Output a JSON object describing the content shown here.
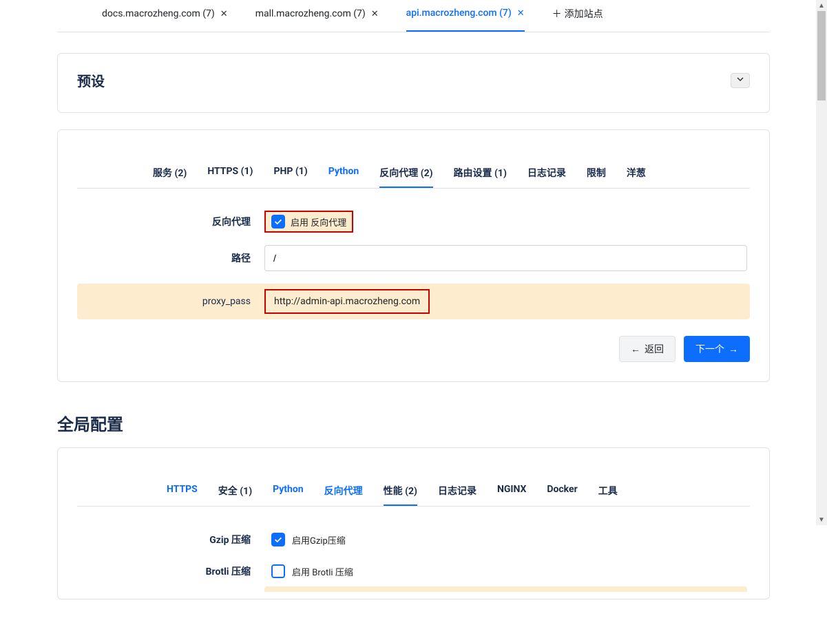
{
  "siteTabs": {
    "tab1": "docs.macrozheng.com (7)",
    "tab2": "mall.macrozheng.com (7)",
    "tab3": "api.macrozheng.com (7)",
    "addSite": "添加站点"
  },
  "presetPanel": {
    "title": "预设",
    "tabs": {
      "service": "服务 (2)",
      "https": "HTTPS (1)",
      "php": "PHP (1)",
      "python": "Python",
      "reverseProxy": "反向代理 (2)",
      "routing": "路由设置 (1)",
      "logging": "日志记录",
      "limit": "限制",
      "onion": "洋葱"
    },
    "form": {
      "reverseProxyLabel": "反向代理",
      "enableReverseProxy": "启用 反向代理",
      "pathLabel": "路径",
      "pathValue": "/",
      "proxyPassLabel": "proxy_pass",
      "proxyPassValue": "http://admin-api.macrozheng.com"
    },
    "buttons": {
      "back": "返回",
      "next": "下一个"
    }
  },
  "globalSection": {
    "title": "全局配置",
    "tabs": {
      "https": "HTTPS",
      "security": "安全 (1)",
      "python": "Python",
      "reverseProxy": "反向代理",
      "performance": "性能 (2)",
      "logging": "日志记录",
      "nginx": "NGINX",
      "docker": "Docker",
      "tools": "工具"
    },
    "form": {
      "gzipLabel": "Gzip 压缩",
      "enableGzip": "启用Gzip压缩",
      "brotliLabel": "Brotli 压缩",
      "enableBrotli": "启用 Brotli 压缩"
    }
  }
}
